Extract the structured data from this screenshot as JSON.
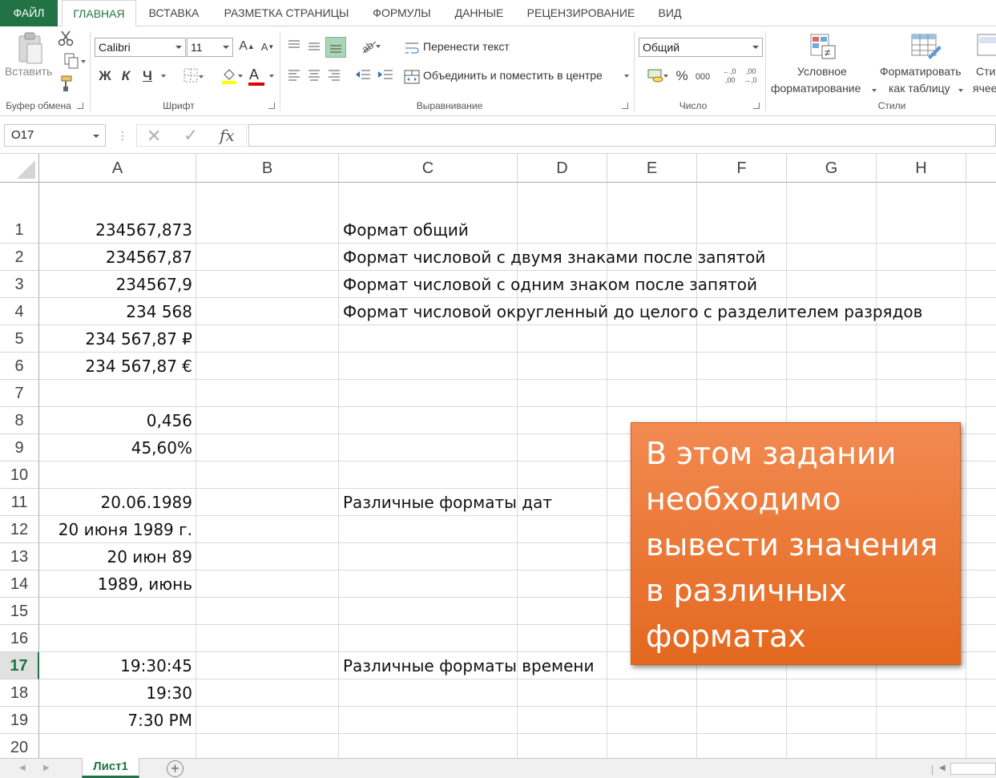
{
  "ribbon_tabs": [
    "ФАЙЛ",
    "ГЛАВНАЯ",
    "ВСТАВКА",
    "РАЗМЕТКА СТРАНИЦЫ",
    "ФОРМУЛЫ",
    "ДАННЫЕ",
    "РЕЦЕНЗИРОВАНИЕ",
    "ВИД"
  ],
  "clipboard": {
    "paste_label": "Вставить",
    "group_label": "Буфер обмена"
  },
  "font": {
    "name": "Calibri",
    "size": "11",
    "bold": "Ж",
    "italic": "К",
    "underline": "Ч",
    "grow": "A",
    "shrink": "A",
    "color_glyph": "A",
    "group_label": "Шрифт"
  },
  "alignment": {
    "wrap_text": "Перенести текст",
    "merge_center": "Объединить и поместить в центре",
    "group_label": "Выравнивание"
  },
  "number": {
    "format": "Общий",
    "percent": "%",
    "thousands": "000",
    "inc_decimal": "←,0\n,00",
    "dec_decimal": ",00\n→,0",
    "group_label": "Число"
  },
  "styles": {
    "conditional_line1": "Условное",
    "conditional_line2": "форматирование",
    "table_line1": "Форматировать",
    "table_line2": "как таблицу",
    "cell_line1": "Сти",
    "cell_line2": "ячее",
    "group_label": "Стили"
  },
  "formula_bar": {
    "name_box": "O17",
    "fx": "fx",
    "formula": ""
  },
  "columns": [
    "A",
    "B",
    "C",
    "D",
    "E",
    "F",
    "G",
    "H"
  ],
  "rows": [
    {
      "n": "1",
      "a": "234567,873",
      "c": "Формат общий"
    },
    {
      "n": "2",
      "a": "234567,87",
      "c": "Формат числовой с двумя знаками после запятой"
    },
    {
      "n": "3",
      "a": "234567,9",
      "c": "Формат числовой с одним знаком после запятой"
    },
    {
      "n": "4",
      "a": "234 568 ",
      "c": "Формат числовой округленный до целого с разделителем разрядов"
    },
    {
      "n": "5",
      "a": "234 567,87 ₽",
      "c": ""
    },
    {
      "n": "6",
      "a": "234 567,87 €",
      "c": ""
    },
    {
      "n": "7",
      "a": "",
      "c": ""
    },
    {
      "n": "8",
      "a": "0,456",
      "c": ""
    },
    {
      "n": "9",
      "a": "45,60%",
      "c": ""
    },
    {
      "n": "10",
      "a": "",
      "c": ""
    },
    {
      "n": "11",
      "a": "20.06.1989",
      "c": "Различные форматы дат"
    },
    {
      "n": "12",
      "a": "20 июня 1989 г.",
      "c": ""
    },
    {
      "n": "13",
      "a": "20 июн 89",
      "c": ""
    },
    {
      "n": "14",
      "a": "1989, июнь",
      "c": ""
    },
    {
      "n": "15",
      "a": "",
      "c": ""
    },
    {
      "n": "16",
      "a": "",
      "c": ""
    },
    {
      "n": "17",
      "a": "19:30:45",
      "c": "Различные форматы времени"
    },
    {
      "n": "18",
      "a": "19:30",
      "c": ""
    },
    {
      "n": "19",
      "a": "7:30 PM",
      "c": ""
    },
    {
      "n": "20",
      "a": "",
      "c": ""
    }
  ],
  "active_row": "17",
  "callout": {
    "text": "В этом задании необходимо вывести значения в различных форматах",
    "color": "#ed7d31"
  },
  "sheet_tabs": {
    "active": "Лист1",
    "add": "+"
  },
  "accent": "#217346"
}
